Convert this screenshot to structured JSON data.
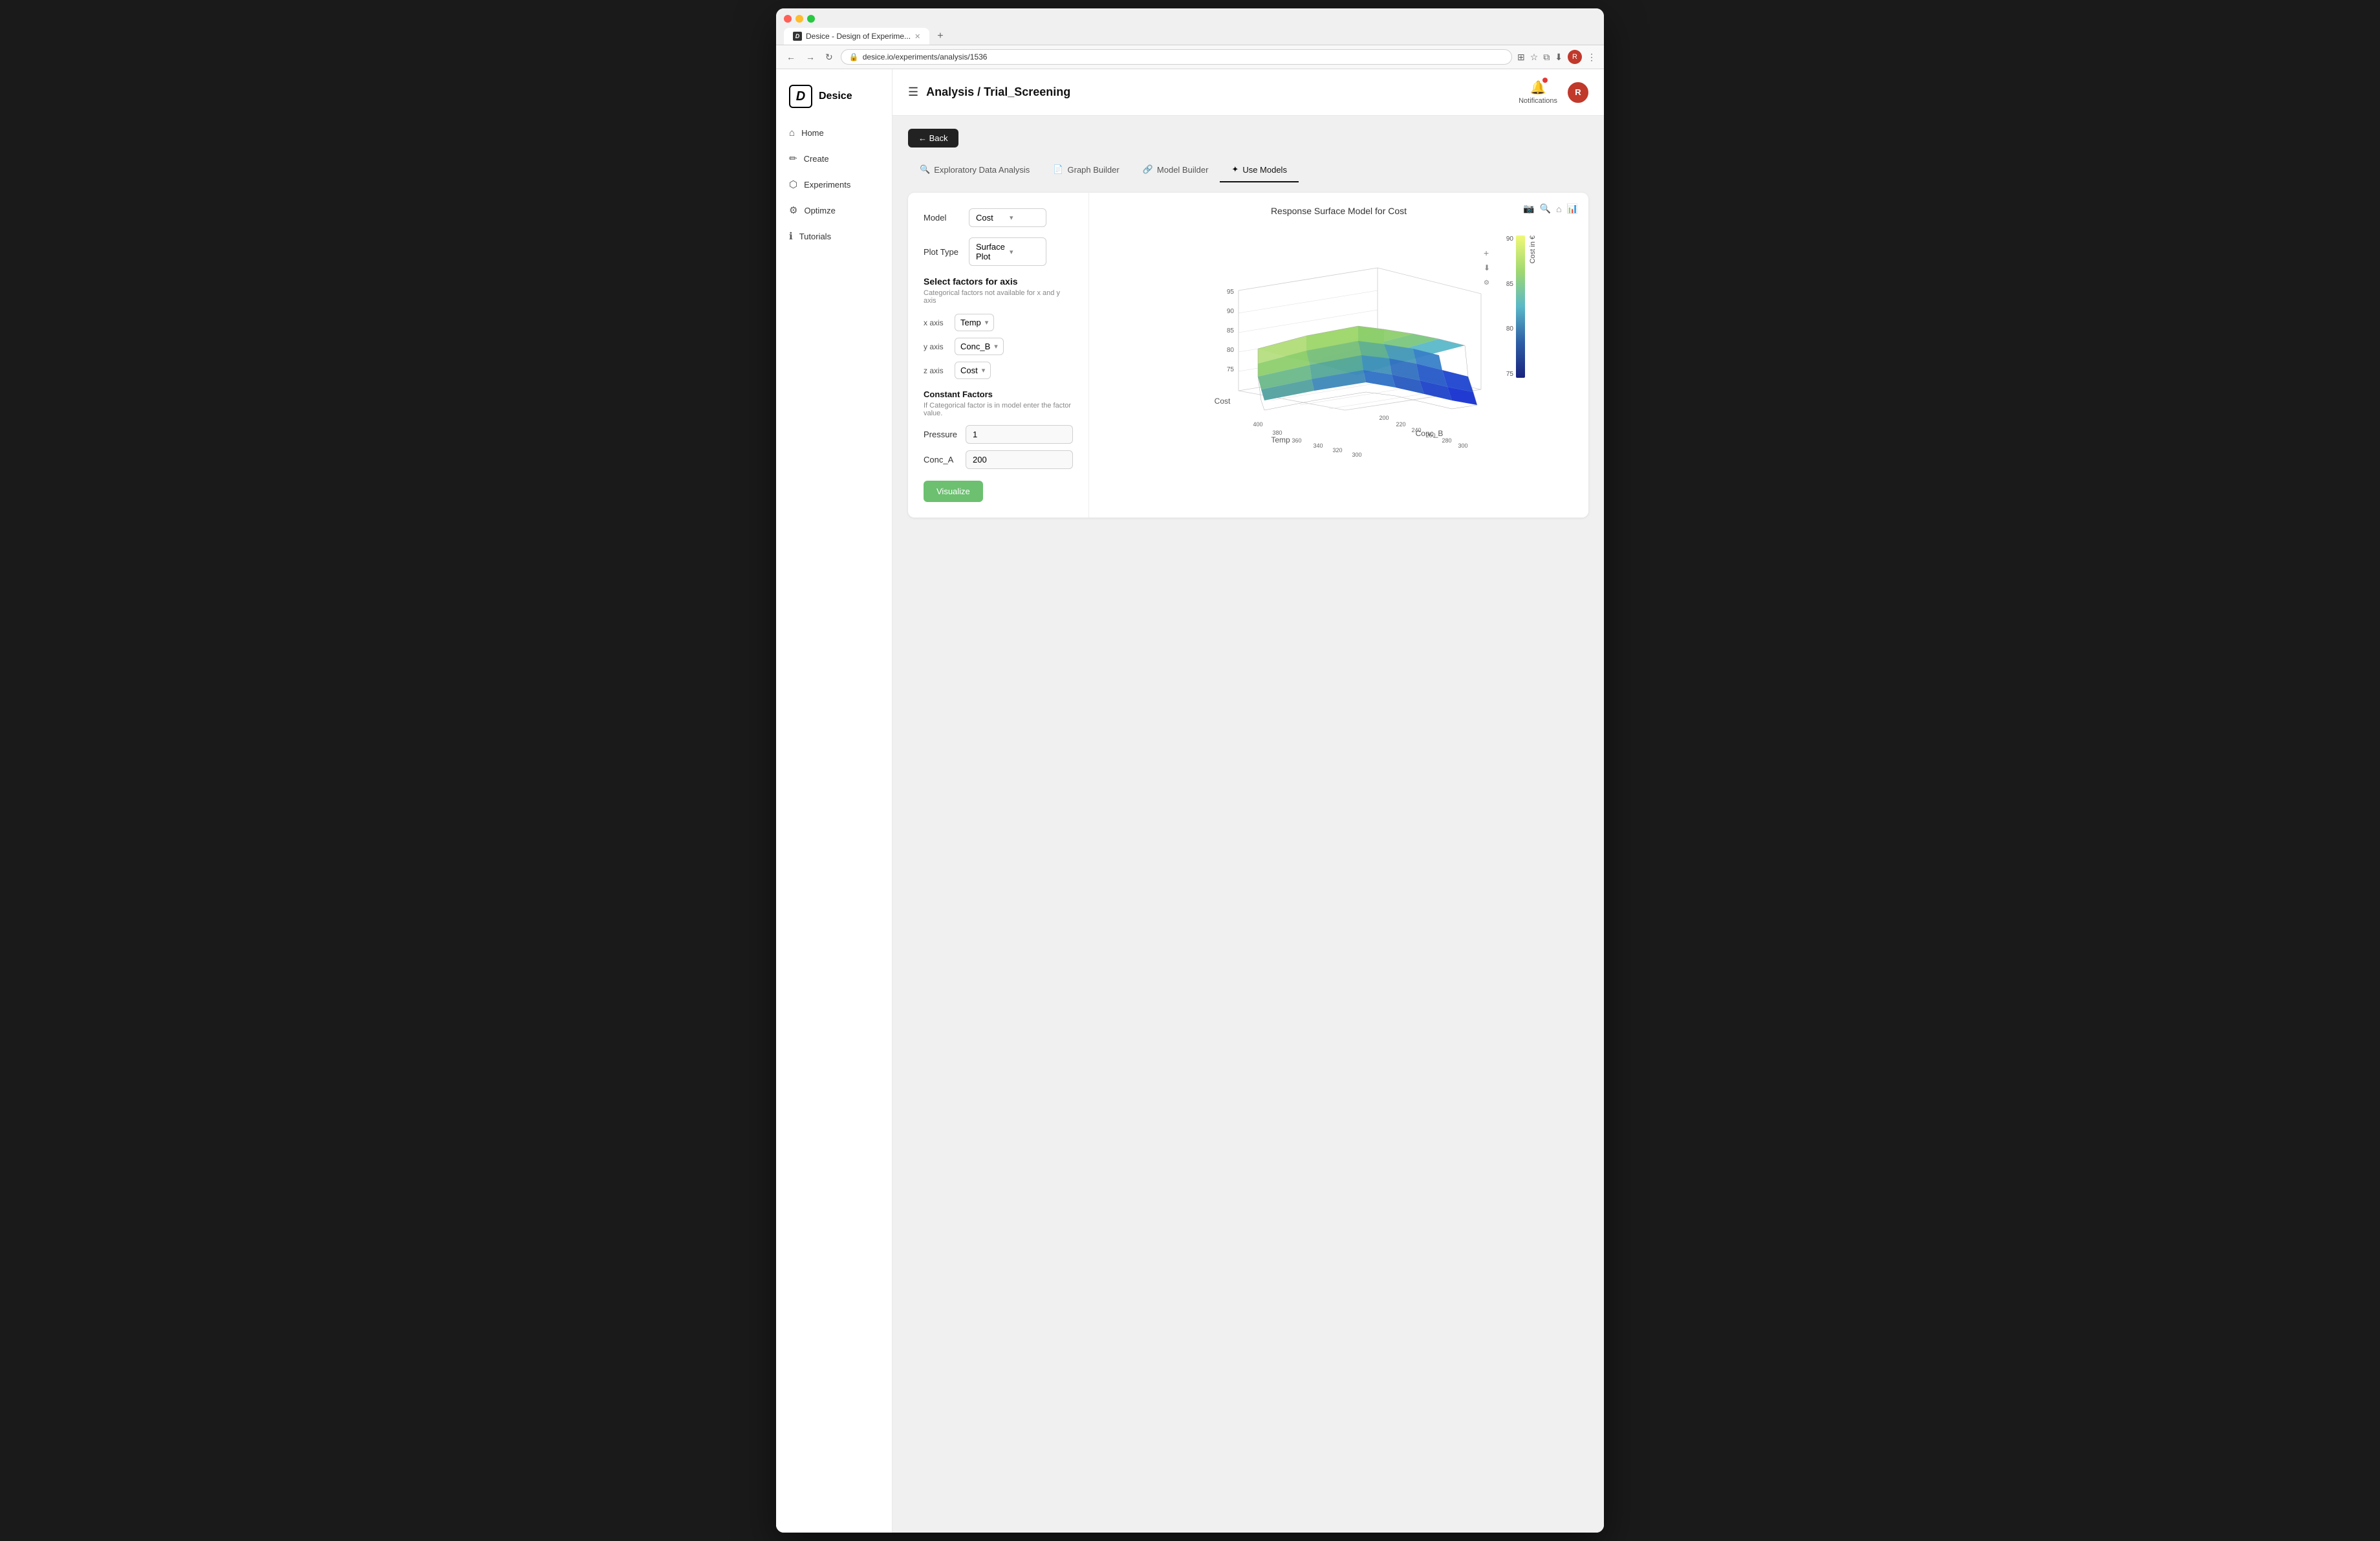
{
  "browser": {
    "tab_title": "Desice - Design of Experime...",
    "url": "desice.io/experiments/analysis/1536",
    "new_tab_label": "+"
  },
  "header": {
    "menu_icon": "☰",
    "breadcrumb": "Analysis / Trial_Screening",
    "notifications_label": "Notifications",
    "user_initials": "R",
    "back_label": "← Back"
  },
  "logo": {
    "icon_text": "D",
    "app_name": "Desice"
  },
  "nav": {
    "items": [
      {
        "id": "home",
        "label": "Home",
        "icon": "⌂"
      },
      {
        "id": "create",
        "label": "Create",
        "icon": "✏"
      },
      {
        "id": "experiments",
        "label": "Experiments",
        "icon": "⬡"
      },
      {
        "id": "optimize",
        "label": "Optimze",
        "icon": "⚙"
      },
      {
        "id": "tutorials",
        "label": "Tutorials",
        "icon": "ℹ"
      }
    ]
  },
  "tabs": [
    {
      "id": "eda",
      "label": "Exploratory Data Analysis",
      "icon": "🔍",
      "active": false
    },
    {
      "id": "graph",
      "label": "Graph Builder",
      "icon": "📄",
      "active": false
    },
    {
      "id": "model",
      "label": "Model Builder",
      "icon": "🔗",
      "active": false
    },
    {
      "id": "use_models",
      "label": "Use Models",
      "icon": "✦",
      "active": true
    }
  ],
  "left_panel": {
    "model_label": "Model",
    "model_value": "Cost",
    "plot_type_label": "Plot Type",
    "plot_type_value": "Surface Plot",
    "select_factors_title": "Select factors for axis",
    "select_factors_sub": "Categorical factors not available for x and y axis",
    "x_axis_label": "x axis",
    "x_axis_value": "Temp",
    "y_axis_label": "y axis",
    "y_axis_value": "Conc_B",
    "z_axis_label": "z axis",
    "z_axis_value": "Cost",
    "constant_factors_title": "Constant Factors",
    "constant_factors_sub": "If Categorical factor is in model enter the factor value.",
    "pressure_label": "Pressure",
    "pressure_value": "1",
    "conc_a_label": "Conc_A",
    "conc_a_value": "200",
    "visualize_label": "Visualize"
  },
  "chart": {
    "title": "Response Surface Model for Cost",
    "color_scale": {
      "values": [
        "90",
        "85",
        "80",
        "75"
      ],
      "axis_label": "Cost in €"
    },
    "z_axis_label": "Cost",
    "x_axis_label": "Temp",
    "y_axis_label": "Conc_B",
    "z_tick_labels": [
      "95",
      "90",
      "85",
      "80",
      "75"
    ],
    "x_tick_labels": [
      "400",
      "380",
      "360",
      "340",
      "320",
      "300"
    ],
    "y_tick_labels": [
      "200",
      "220",
      "240",
      "260",
      "280",
      "300"
    ]
  },
  "chart_buttons": {
    "camera_label": "📷",
    "zoom_label": "🔍",
    "home_label": "⌂",
    "bar_label": "📊",
    "plus_label": "+",
    "download_label": "⬇"
  }
}
